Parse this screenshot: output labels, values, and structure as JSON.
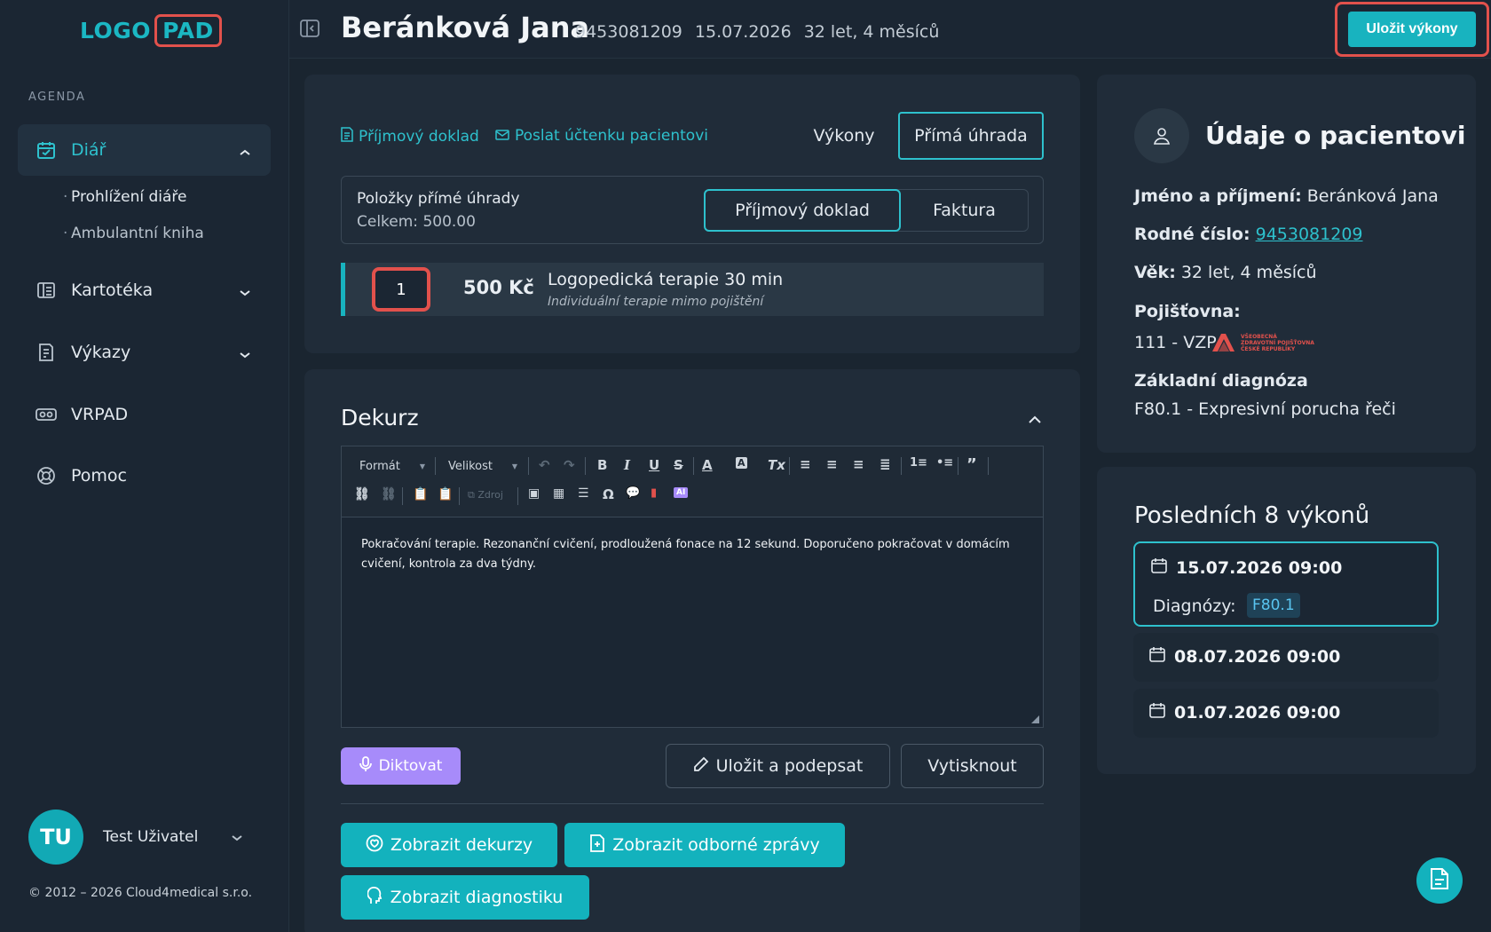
{
  "app": {
    "logo_part1": "LOGO",
    "logo_part2": "PAD"
  },
  "sidebar": {
    "section": "AGENDA",
    "items": [
      {
        "label": "Diář",
        "icon": "calendar-icon",
        "active": true
      },
      {
        "label": "Kartotéka",
        "icon": "cards-icon"
      },
      {
        "label": "Výkazy",
        "icon": "report-icon"
      },
      {
        "label": "VRPAD",
        "icon": "vr-icon"
      },
      {
        "label": "Pomoc",
        "icon": "help-icon"
      }
    ],
    "subitems": [
      "Prohlížení diáře",
      "Ambulantní kniha"
    ],
    "user": {
      "initials": "TU",
      "name": "Test Uživatel"
    },
    "copyright": "© 2012 – 2026 Cloud4medical s.r.o."
  },
  "header": {
    "patient_name": "Beránková Jana",
    "birth_number": "9453081209",
    "date": "15.07.2026",
    "age": "32 let, 4 měsíců",
    "save_label": "Uložit výkony"
  },
  "payment": {
    "link_receipt": "Příjmový doklad",
    "link_send": "Poslat účtenku pacientovi",
    "tab_services": "Výkony",
    "tab_direct": "Přímá úhrada",
    "box_title": "Položky přímé úhrady",
    "box_total": "Celkem: 500.00",
    "seg_receipt": "Příjmový doklad",
    "seg_invoice": "Faktura",
    "item": {
      "qty": "1",
      "price": "500 Kč",
      "name": "Logopedická terapie 30 min",
      "subtitle": "Individuální terapie mimo pojištění"
    }
  },
  "dekurz": {
    "title": "Dekurz",
    "toolbar": {
      "format": "Formát",
      "size": "Velikost",
      "source": "Zdroj"
    },
    "text": "Pokračování terapie. Rezonanční cvičení, prodloužená fonace na 12 sekund. Doporučeno pokračovat v domácím cvičení, kontrola za dva týdny.",
    "dictate": "Diktovat",
    "save_sign": "Uložit a podepsat",
    "print": "Vytisknout",
    "show_dekurzy": "Zobrazit dekurzy",
    "show_reports": "Zobrazit odborné zprávy",
    "show_diag": "Zobrazit diagnostiku"
  },
  "patient_info": {
    "title": "Údaje o pacientovi",
    "name_label": "Jméno a příjmení:",
    "name_value": "Beránková Jana",
    "rc_label": "Rodné číslo:",
    "rc_value": "9453081209",
    "age_label": "Věk:",
    "age_value": "32 let, 4 měsíců",
    "insurance_label": "Pojišťovna:",
    "insurance_value": "111 - VZP",
    "insurance_logo_text": "VŠEOBECNÁ ZDRAVOTNÍ POJIŠŤOVNA ČESKÉ REPUBLIKY",
    "diag_label": "Základní diagnóza",
    "diag_value": "F80.1 - Expresivní porucha řeči"
  },
  "last_visits": {
    "title": "Posledních 8 výkonů",
    "diag_label": "Diagnózy:",
    "items": [
      {
        "datetime": "15.07.2026 09:00",
        "diagnosis": "F80.1"
      },
      {
        "datetime": "08.07.2026 09:00"
      },
      {
        "datetime": "01.07.2026 09:00"
      }
    ]
  },
  "colors": {
    "accent": "#18b3bf",
    "highlight": "#e2514c",
    "purple": "#a78bfa"
  }
}
